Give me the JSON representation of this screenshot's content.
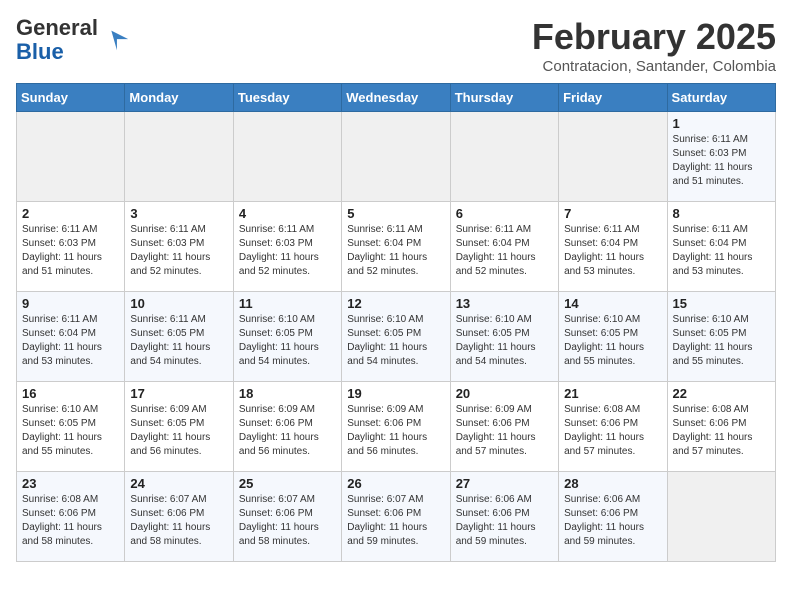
{
  "header": {
    "logo_general": "General",
    "logo_blue": "Blue",
    "month_title": "February 2025",
    "subtitle": "Contratacion, Santander, Colombia"
  },
  "days_of_week": [
    "Sunday",
    "Monday",
    "Tuesday",
    "Wednesday",
    "Thursday",
    "Friday",
    "Saturday"
  ],
  "weeks": [
    [
      {
        "day": "",
        "info": ""
      },
      {
        "day": "",
        "info": ""
      },
      {
        "day": "",
        "info": ""
      },
      {
        "day": "",
        "info": ""
      },
      {
        "day": "",
        "info": ""
      },
      {
        "day": "",
        "info": ""
      },
      {
        "day": "1",
        "info": "Sunrise: 6:11 AM\nSunset: 6:03 PM\nDaylight: 11 hours\nand 51 minutes."
      }
    ],
    [
      {
        "day": "2",
        "info": "Sunrise: 6:11 AM\nSunset: 6:03 PM\nDaylight: 11 hours\nand 51 minutes."
      },
      {
        "day": "3",
        "info": "Sunrise: 6:11 AM\nSunset: 6:03 PM\nDaylight: 11 hours\nand 52 minutes."
      },
      {
        "day": "4",
        "info": "Sunrise: 6:11 AM\nSunset: 6:03 PM\nDaylight: 11 hours\nand 52 minutes."
      },
      {
        "day": "5",
        "info": "Sunrise: 6:11 AM\nSunset: 6:04 PM\nDaylight: 11 hours\nand 52 minutes."
      },
      {
        "day": "6",
        "info": "Sunrise: 6:11 AM\nSunset: 6:04 PM\nDaylight: 11 hours\nand 52 minutes."
      },
      {
        "day": "7",
        "info": "Sunrise: 6:11 AM\nSunset: 6:04 PM\nDaylight: 11 hours\nand 53 minutes."
      },
      {
        "day": "8",
        "info": "Sunrise: 6:11 AM\nSunset: 6:04 PM\nDaylight: 11 hours\nand 53 minutes."
      }
    ],
    [
      {
        "day": "9",
        "info": "Sunrise: 6:11 AM\nSunset: 6:04 PM\nDaylight: 11 hours\nand 53 minutes."
      },
      {
        "day": "10",
        "info": "Sunrise: 6:11 AM\nSunset: 6:05 PM\nDaylight: 11 hours\nand 54 minutes."
      },
      {
        "day": "11",
        "info": "Sunrise: 6:10 AM\nSunset: 6:05 PM\nDaylight: 11 hours\nand 54 minutes."
      },
      {
        "day": "12",
        "info": "Sunrise: 6:10 AM\nSunset: 6:05 PM\nDaylight: 11 hours\nand 54 minutes."
      },
      {
        "day": "13",
        "info": "Sunrise: 6:10 AM\nSunset: 6:05 PM\nDaylight: 11 hours\nand 54 minutes."
      },
      {
        "day": "14",
        "info": "Sunrise: 6:10 AM\nSunset: 6:05 PM\nDaylight: 11 hours\nand 55 minutes."
      },
      {
        "day": "15",
        "info": "Sunrise: 6:10 AM\nSunset: 6:05 PM\nDaylight: 11 hours\nand 55 minutes."
      }
    ],
    [
      {
        "day": "16",
        "info": "Sunrise: 6:10 AM\nSunset: 6:05 PM\nDaylight: 11 hours\nand 55 minutes."
      },
      {
        "day": "17",
        "info": "Sunrise: 6:09 AM\nSunset: 6:05 PM\nDaylight: 11 hours\nand 56 minutes."
      },
      {
        "day": "18",
        "info": "Sunrise: 6:09 AM\nSunset: 6:06 PM\nDaylight: 11 hours\nand 56 minutes."
      },
      {
        "day": "19",
        "info": "Sunrise: 6:09 AM\nSunset: 6:06 PM\nDaylight: 11 hours\nand 56 minutes."
      },
      {
        "day": "20",
        "info": "Sunrise: 6:09 AM\nSunset: 6:06 PM\nDaylight: 11 hours\nand 57 minutes."
      },
      {
        "day": "21",
        "info": "Sunrise: 6:08 AM\nSunset: 6:06 PM\nDaylight: 11 hours\nand 57 minutes."
      },
      {
        "day": "22",
        "info": "Sunrise: 6:08 AM\nSunset: 6:06 PM\nDaylight: 11 hours\nand 57 minutes."
      }
    ],
    [
      {
        "day": "23",
        "info": "Sunrise: 6:08 AM\nSunset: 6:06 PM\nDaylight: 11 hours\nand 58 minutes."
      },
      {
        "day": "24",
        "info": "Sunrise: 6:07 AM\nSunset: 6:06 PM\nDaylight: 11 hours\nand 58 minutes."
      },
      {
        "day": "25",
        "info": "Sunrise: 6:07 AM\nSunset: 6:06 PM\nDaylight: 11 hours\nand 58 minutes."
      },
      {
        "day": "26",
        "info": "Sunrise: 6:07 AM\nSunset: 6:06 PM\nDaylight: 11 hours\nand 59 minutes."
      },
      {
        "day": "27",
        "info": "Sunrise: 6:06 AM\nSunset: 6:06 PM\nDaylight: 11 hours\nand 59 minutes."
      },
      {
        "day": "28",
        "info": "Sunrise: 6:06 AM\nSunset: 6:06 PM\nDaylight: 11 hours\nand 59 minutes."
      },
      {
        "day": "",
        "info": ""
      }
    ]
  ]
}
